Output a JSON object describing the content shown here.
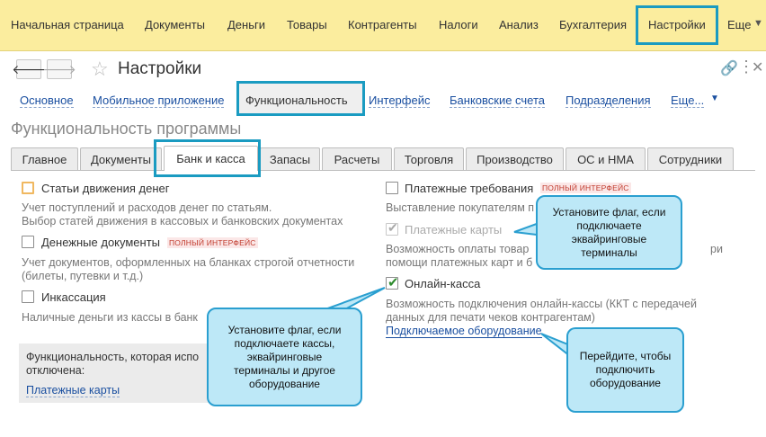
{
  "topmenu": {
    "items": [
      "Начальная страница",
      "Документы",
      "Деньги",
      "Товары",
      "Контрагенты",
      "Налоги",
      "Анализ",
      "Бухгалтерия",
      "Настройки",
      "Еще"
    ]
  },
  "window": {
    "title": "Настройки",
    "back_icon": "arrow-left-icon",
    "forward_icon": "arrow-right-icon"
  },
  "sections": {
    "items": [
      "Основное",
      "Мобильное приложение",
      "Функциональность",
      "Интерфейс",
      "Банковские счета",
      "Подразделения",
      "Еще..."
    ]
  },
  "page_title": "Функциональность программы",
  "tabs": [
    "Главное",
    "Документы",
    "Банк и касса",
    "Запасы",
    "Расчеты",
    "Торговля",
    "Производство",
    "ОС и НМА",
    "Сотрудники"
  ],
  "left": {
    "opt1": {
      "label": "Статьи движения денег",
      "desc1": "Учет поступлений и расходов денег по статьям.",
      "desc2": "Выбор статей движения в кассовых и банковских документах"
    },
    "opt2": {
      "label": "Денежные документы",
      "badge": "ПОЛНЫЙ ИНТЕРФЕЙС",
      "desc1": "Учет документов, оформленных на бланках строгой отчетности",
      "desc2": "(билеты, путевки и т.д.)"
    },
    "opt3": {
      "label": "Инкассация",
      "desc1": "Наличные деньги из кассы в банк"
    },
    "disabled_box": {
      "line1": "Функциональность, которая испо",
      "line2": "отключена:",
      "link": "Платежные карты"
    }
  },
  "right": {
    "opt1": {
      "label": "Платежные требования",
      "badge": "ПОЛНЫЙ ИНТЕРФЕЙС",
      "desc1": "Выставление покупателям п"
    },
    "opt2": {
      "label": "Платежные карты",
      "desc1": "Возможность оплаты товар",
      "desc1_tail": "ри",
      "desc2": "помощи платежных карт и б"
    },
    "opt3": {
      "label": "Онлайн-касса",
      "desc1": "Возможность подключения онлайн-кассы (ККТ с передачей",
      "desc2": "данных для печати чеков контрагентам)"
    },
    "hw_link": "Подключаемое оборудование"
  },
  "callouts": {
    "c1": [
      "Установите флаг, если",
      "подключаете",
      "эквайринговые",
      "терминалы"
    ],
    "c2": [
      "Установите флаг, если",
      "подключаете кассы,",
      "эквайринговые",
      "терминалы и другое",
      "оборудование"
    ],
    "c3": [
      "Перейдите, чтобы",
      "подключить",
      "оборудование"
    ]
  },
  "colors": {
    "accent": "#1a9bc1",
    "callout_fill": "#bde8f7",
    "link": "#1a4fa0",
    "check": "#2e8b2e"
  }
}
